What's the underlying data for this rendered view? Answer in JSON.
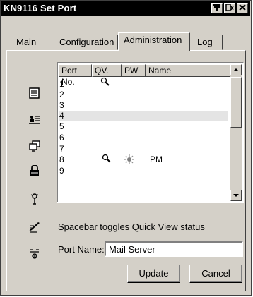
{
  "window": {
    "title": "KN9116 Set Port",
    "controls": [
      "help-icon",
      "maximize-icon",
      "close-icon"
    ]
  },
  "tabs": [
    {
      "label": "Main",
      "active": false
    },
    {
      "label": "Configuration",
      "active": false
    },
    {
      "label": "Administration",
      "active": true
    },
    {
      "label": "Log",
      "active": false
    }
  ],
  "list": {
    "headers": [
      "Port No.",
      "QV.",
      "PW",
      "Name"
    ],
    "rows": [
      {
        "port": "1",
        "qv": true,
        "pw": false,
        "name": ""
      },
      {
        "port": "2",
        "qv": false,
        "pw": false,
        "name": ""
      },
      {
        "port": "3",
        "qv": false,
        "pw": false,
        "name": ""
      },
      {
        "port": "4",
        "qv": false,
        "pw": false,
        "name": "",
        "selected": true
      },
      {
        "port": "5",
        "qv": false,
        "pw": false,
        "name": ""
      },
      {
        "port": "6",
        "qv": false,
        "pw": false,
        "name": ""
      },
      {
        "port": "7",
        "qv": false,
        "pw": false,
        "name": ""
      },
      {
        "port": "8",
        "qv": true,
        "pw": true,
        "name": "PM"
      },
      {
        "port": "9",
        "qv": false,
        "pw": false,
        "name": ""
      }
    ]
  },
  "sidebar_icons": [
    "document-icon",
    "id-card-icon",
    "screens-icon",
    "lock-icon",
    "user-icon",
    "quick-view-edit-icon",
    "port-name-icon"
  ],
  "hint": "Spacebar toggles Quick View status",
  "port_name": {
    "label": "Port Name:",
    "value": "Mail Server"
  },
  "buttons": {
    "update": "Update",
    "cancel": "Cancel"
  }
}
